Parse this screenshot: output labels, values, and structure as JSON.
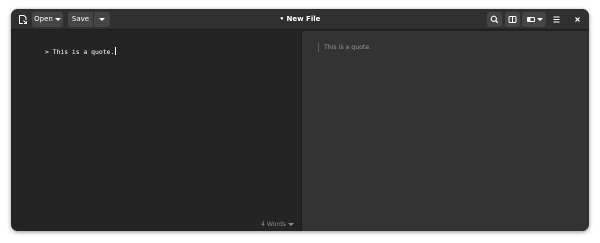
{
  "window": {
    "title": "• New File"
  },
  "headerbar": {
    "new_document_icon": "new-document-icon",
    "open_label": "Open",
    "save_label": "Save",
    "search_icon": "search-icon",
    "preview_toggle_icon": "split-view-icon",
    "view_mode_icon": "view-mode-icon",
    "menu_icon": "hamburger-menu-icon",
    "close_icon": "close-icon"
  },
  "editor": {
    "content": "> This is a quote."
  },
  "preview": {
    "quote_text": "This is a quote."
  },
  "status": {
    "word_count": "4 Words"
  },
  "colors": {
    "window_bg": "#242424",
    "headerbar_bg": "#303030",
    "preview_bg": "#333333",
    "button_bg": "#454545",
    "text": "#ffffff",
    "muted_text": "#9a9a9a"
  }
}
